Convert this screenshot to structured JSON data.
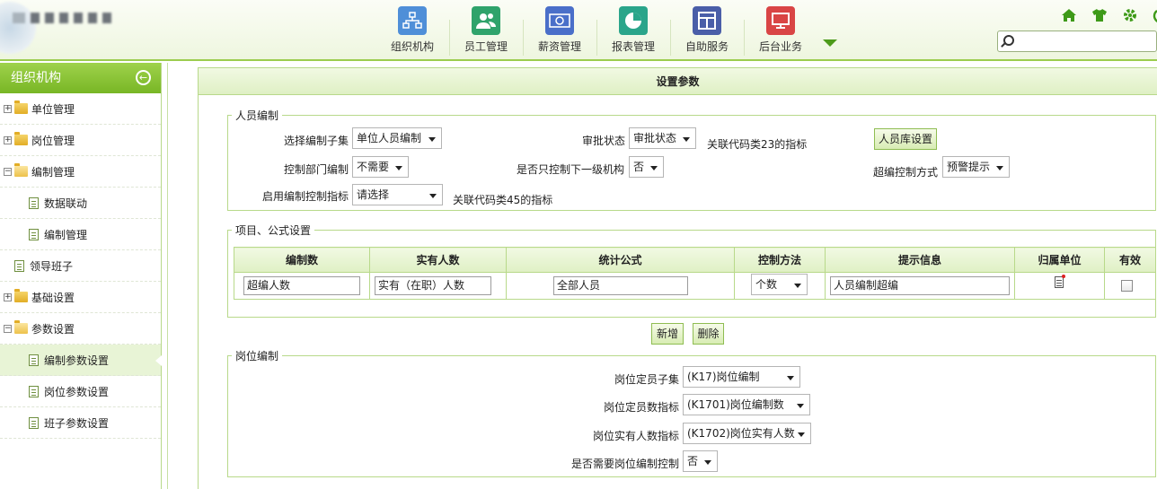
{
  "header": {
    "title_blurred": "logo + blurred brand text",
    "nav": [
      {
        "label": "组织机构",
        "icon": "org-chart-icon",
        "color": "#4f8fd8"
      },
      {
        "label": "员工管理",
        "icon": "users-icon",
        "color": "#2fa36b"
      },
      {
        "label": "薪资管理",
        "icon": "money-icon",
        "color": "#4a6fc9"
      },
      {
        "label": "报表管理",
        "icon": "pie-chart-icon",
        "color": "#2aa58a"
      },
      {
        "label": "自助服务",
        "icon": "window-icon",
        "color": "#4a5ea8"
      },
      {
        "label": "后台业务",
        "icon": "monitor-icon",
        "color": "#d94545"
      }
    ],
    "search": {
      "value": "",
      "placeholder": ""
    }
  },
  "sidebar": {
    "title": "组织机构",
    "items": [
      {
        "label": "单位管理"
      },
      {
        "label": "岗位管理"
      },
      {
        "label": "编制管理"
      },
      {
        "label": "数据联动"
      },
      {
        "label": "编制管理"
      },
      {
        "label": "领导班子"
      },
      {
        "label": "基础设置"
      },
      {
        "label": "参数设置"
      },
      {
        "label": "编制参数设置"
      },
      {
        "label": "岗位参数设置"
      },
      {
        "label": "班子参数设置"
      }
    ]
  },
  "main": {
    "title": "设置参数",
    "section1": {
      "legend": "人员编制",
      "subset": {
        "label": "选择编制子集",
        "value": "单位人员编制"
      },
      "approval": {
        "label": "审批状态",
        "value": "审批状态",
        "note": "关联代码类23的指标"
      },
      "library_button": "人员库设置",
      "dept": {
        "label": "控制部门编制",
        "value": "不需要"
      },
      "lower": {
        "label": "是否只控制下一级机构",
        "value": "否"
      },
      "mode": {
        "label": "超编控制方式",
        "value": "预警提示"
      },
      "indicator": {
        "label": "启用编制控制指标",
        "value": "请选择",
        "note": "关联代码类45的指标"
      }
    },
    "section2": {
      "legend": "项目、公式设置",
      "columns": [
        "编制数",
        "实有人数",
        "统计公式",
        "控制方法",
        "提示信息",
        "归属单位",
        "有效"
      ],
      "row": {
        "quota": "超编人数",
        "actual": "实有（在职）人数",
        "formula": "全部人员",
        "method": "个数",
        "message": "人员编制超编"
      },
      "add_button": "新增",
      "delete_button": "删除"
    },
    "section3": {
      "legend": "岗位编制",
      "subset": {
        "label": "岗位定员子集",
        "value": "(K17)岗位编制"
      },
      "quota": {
        "label": "岗位定员数指标",
        "value": "(K1701)岗位编制数"
      },
      "actual": {
        "label": "岗位实有人数指标",
        "value": "(K1702)岗位实有人数"
      },
      "control": {
        "label": "是否需要岗位编制控制",
        "value": "否"
      }
    }
  }
}
